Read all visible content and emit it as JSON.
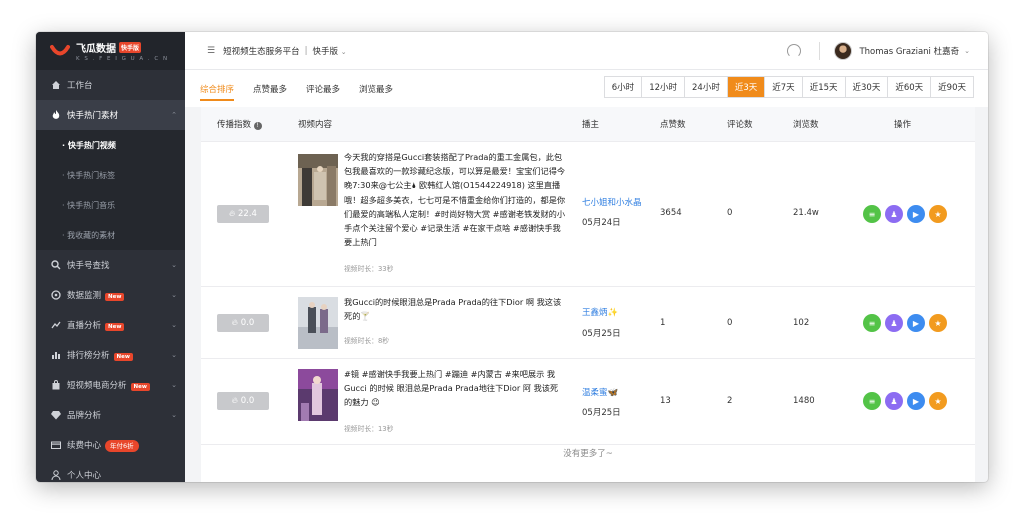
{
  "logo": {
    "title": "飞瓜数据",
    "tag": "快手版",
    "subtitle": "K S . F E I G U A . C N"
  },
  "sidebar": {
    "items": [
      {
        "label": "工作台",
        "icon": "home-icon"
      },
      {
        "label": "快手热门素材",
        "icon": "flame-icon"
      },
      {
        "label": "快手号查找",
        "icon": "search-icon"
      },
      {
        "label": "数据监测",
        "icon": "monitor-icon",
        "badge": "New"
      },
      {
        "label": "直播分析",
        "icon": "live-icon",
        "badge": "New"
      },
      {
        "label": "排行榜分析",
        "icon": "bar-chart-icon",
        "badge": "New"
      },
      {
        "label": "短视频电商分析",
        "icon": "shopping-bag-icon",
        "badge": "New"
      },
      {
        "label": "品牌分析",
        "icon": "diamond-icon"
      },
      {
        "label": "续费中心",
        "icon": "card-icon",
        "badge": "年付6折"
      },
      {
        "label": "个人中心",
        "icon": "user-icon"
      }
    ],
    "sub_items": [
      "· 快手热门视频",
      "· 快手热门标签",
      "· 快手热门音乐",
      "· 我收藏的素材"
    ]
  },
  "header": {
    "platform": "短视频生态服务平台",
    "separator": "|",
    "version": "快手版",
    "username": "Thomas Graziani 杜嘉奇"
  },
  "filters": {
    "tabs": [
      "综合排序",
      "点赞最多",
      "评论最多",
      "浏览最多"
    ],
    "ranges": [
      "6小时",
      "12小时",
      "24小时",
      "近3天",
      "近7天",
      "近15天",
      "近30天",
      "近60天",
      "近90天"
    ],
    "active_range": "近3天"
  },
  "table": {
    "headers": [
      "传播指数",
      "视频内容",
      "播主",
      "点赞数",
      "评论数",
      "浏览数",
      "操作"
    ],
    "rows": [
      {
        "score": "22.4",
        "content": "今天我的穿搭是Gucci套装搭配了Prada的重工金属包，此包包我最喜欢的一款珍藏纪念版，可以算是最爱！宝宝们记得今晚7:30来@七公主🌢 欧韩红人馆(O1544224918) 这里直播哦！超多超多美衣，七七可是不惜重金给你们打造的，都是你们最爱的高端私人定制！#时尚好物大赏 #感谢老铁发财的小手点个关注留个爱心 #记录生活 #在家干点啥 #感谢快手我要上热门",
        "duration": "视频时长：33秒",
        "author": "七小姐和小水晶",
        "date": "05月24日",
        "likes": "3654",
        "comments": "0",
        "views": "21.4w"
      },
      {
        "score": "0.0",
        "content": "我Gucci的时候眼泪总是Prada Prada的往下Dior 啊 我这该死的🍸",
        "duration": "视频时长：8秒",
        "author": "王鑫炳✨",
        "date": "05月25日",
        "likes": "1",
        "comments": "0",
        "views": "102"
      },
      {
        "score": "0.0",
        "content": "#镜 #感谢快手我要上热门 #蹦迪 #内蒙古 #来吧展示 我Gucci 的时候 眼泪总是Prada Prada地往下Dior 阿 我该死的魅力 😉",
        "duration": "视频时长：13秒",
        "author": "温柔蜜🦋",
        "date": "05月25日",
        "likes": "13",
        "comments": "2",
        "views": "1480"
      }
    ],
    "footer": "没有更多了~"
  },
  "colors": {
    "accent": "#f08b1b",
    "sidebar": "#2d3038",
    "link": "#2f7ee0",
    "badge": "#e8462b"
  }
}
